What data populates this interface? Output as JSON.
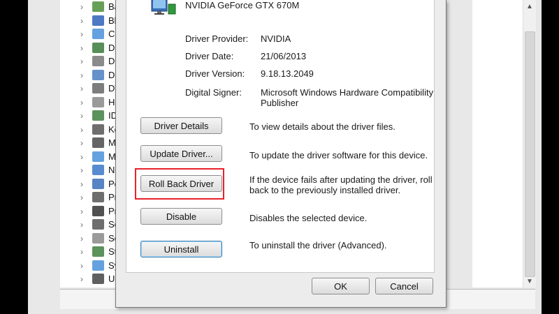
{
  "device_tree": {
    "items": [
      {
        "label": "Batteries",
        "icon": "battery-icon"
      },
      {
        "label": "Bluetooth",
        "icon": "bluetooth-icon"
      },
      {
        "label": "Computer",
        "icon": "computer-icon"
      },
      {
        "label": "Digital M",
        "icon": "digital-media-icon"
      },
      {
        "label": "Disk drive",
        "icon": "disk-drive-icon"
      },
      {
        "label": "Display a",
        "icon": "display-adapter-icon"
      },
      {
        "label": "DVD/CD-",
        "icon": "dvd-drive-icon"
      },
      {
        "label": "Human I",
        "icon": "human-interface-icon"
      },
      {
        "label": "IDE ATA/",
        "icon": "ide-controller-icon"
      },
      {
        "label": "Keyboard",
        "icon": "keyboard-icon"
      },
      {
        "label": "Mice and",
        "icon": "mouse-icon"
      },
      {
        "label": "Monitors",
        "icon": "monitor-icon"
      },
      {
        "label": "Network",
        "icon": "network-adapter-icon"
      },
      {
        "label": "Portable",
        "icon": "portable-device-icon"
      },
      {
        "label": "Print que",
        "icon": "printer-icon"
      },
      {
        "label": "Processo",
        "icon": "processor-icon"
      },
      {
        "label": "Software",
        "icon": "software-device-icon"
      },
      {
        "label": "Sound, v",
        "icon": "sound-icon"
      },
      {
        "label": "Storage c",
        "icon": "storage-controller-icon"
      },
      {
        "label": "System c",
        "icon": "system-device-icon"
      },
      {
        "label": "Universa",
        "icon": "usb-icon"
      }
    ]
  },
  "dialog": {
    "device_name": "NVIDIA GeForce GTX 670M",
    "info": {
      "provider_label": "Driver Provider:",
      "provider_value": "NVIDIA",
      "date_label": "Driver Date:",
      "date_value": "21/06/2013",
      "version_label": "Driver Version:",
      "version_value": "9.18.13.2049",
      "signer_label": "Digital Signer:",
      "signer_value_line1": "Microsoft Windows Hardware Compatibility",
      "signer_value_line2": "Publisher"
    },
    "actions": {
      "details_label": "Driver Details",
      "details_desc": "To view details about the driver files.",
      "update_label": "Update Driver...",
      "update_desc": "To update the driver software for this device.",
      "rollback_label": "Roll Back Driver",
      "rollback_desc_line1": "If the device fails after updating the driver, roll",
      "rollback_desc_line2": "back to the previously installed driver.",
      "disable_label": "Disable",
      "disable_desc": "Disables the selected device.",
      "uninstall_label": "Uninstall",
      "uninstall_desc": "To uninstall the driver (Advanced)."
    },
    "ok_label": "OK",
    "cancel_label": "Cancel"
  },
  "colors": {
    "highlight": "#e8202a",
    "focus_border": "#3c7fb1"
  }
}
